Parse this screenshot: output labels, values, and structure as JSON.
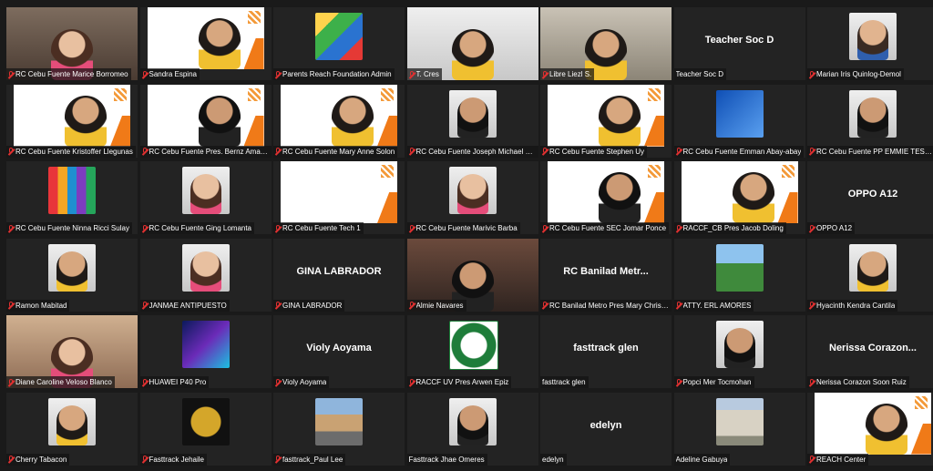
{
  "participants": [
    {
      "name": "RC Cebu Fuente Marice Borromeo",
      "muted": true,
      "type": "camera",
      "skin": "f3",
      "bg": "cam",
      "active": true
    },
    {
      "name": "Sandra Espina",
      "muted": true,
      "type": "poster-camera",
      "poster": "Rotary"
    },
    {
      "name": "Parents Reach Foundation Admin",
      "muted": true,
      "type": "logo",
      "logo": "parents"
    },
    {
      "name": "T. Cres",
      "muted": true,
      "type": "camera",
      "skin": "f2",
      "bg": "cam3"
    },
    {
      "name": "Libre Liezl S.",
      "muted": true,
      "type": "camera",
      "skin": "f2",
      "bg": "cam2"
    },
    {
      "name": "Teacher Soc D",
      "muted": false,
      "type": "name",
      "big": "Teacher Soc D"
    },
    {
      "name": "Marian Iris Quinlog-Demol",
      "muted": true,
      "type": "photo",
      "skin": "f1"
    },
    {
      "name": "RC Cebu Fuente Kristoffer Llegunas",
      "muted": true,
      "type": "poster-camera",
      "poster": "AUTISM WEBINAR"
    },
    {
      "name": "RC Cebu Fuente Pres. Bernz Amante",
      "muted": true,
      "type": "poster-camera",
      "poster": "AUTISM WEBINAR"
    },
    {
      "name": "RC Cebu Fuente Mary Anne Solon",
      "muted": true,
      "type": "poster-camera",
      "poster": "AUTISM WEBINAR"
    },
    {
      "name": "RC Cebu Fuente Joseph Michael Wong",
      "muted": true,
      "type": "photo",
      "skin": "f4"
    },
    {
      "name": "RC Cebu Fuente Stephen Uy",
      "muted": true,
      "type": "poster-camera",
      "poster": "AUTISM WEBINAR"
    },
    {
      "name": "RC Cebu Fuente Emman Abay-abay",
      "muted": true,
      "type": "logo",
      "logo": "blue-screen"
    },
    {
      "name": "RC Cebu Fuente PP EMMIE TESALONA",
      "muted": true,
      "type": "photo",
      "skin": "f4"
    },
    {
      "name": "RC Cebu Fuente Ninna Ricci Sulay",
      "muted": true,
      "type": "logo",
      "logo": "logo-doors"
    },
    {
      "name": "RC Cebu Fuente Ging Lomanta",
      "muted": true,
      "type": "photo",
      "skin": "f3"
    },
    {
      "name": "RC Cebu Fuente Tech 1",
      "muted": true,
      "type": "poster-wide",
      "poster": "AUTISM WEBINAR"
    },
    {
      "name": "RC Cebu Fuente Marivic Barba",
      "muted": true,
      "type": "photo",
      "skin": "f3"
    },
    {
      "name": "RC Cebu Fuente SEC Jomar Ponce",
      "muted": true,
      "type": "poster-camera",
      "poster": "AUTISM WEBINAR"
    },
    {
      "name": "RACCF_CB Pres Jacob Doling",
      "muted": true,
      "type": "poster-camera",
      "poster": "AUTISM WEBINAR"
    },
    {
      "name": "OPPO A12",
      "muted": true,
      "type": "name",
      "big": "OPPO A12"
    },
    {
      "name": "Ramon Mabitad",
      "muted": true,
      "type": "photo",
      "skin": "f2"
    },
    {
      "name": "JANMAE ANTIPUESTO",
      "muted": true,
      "type": "photo",
      "skin": "f3"
    },
    {
      "name": "GINA LABRADOR",
      "muted": true,
      "type": "name",
      "big": "GINA LABRADOR"
    },
    {
      "name": "Almie Navares",
      "muted": true,
      "type": "camera",
      "skin": "f4",
      "bg": "cam4"
    },
    {
      "name": "RC Banilad Metro Pres Mary Christine",
      "muted": true,
      "type": "name",
      "big": "RC Banilad Metr..."
    },
    {
      "name": "ATTY. ERL AMORES",
      "muted": true,
      "type": "logo",
      "logo": "nature"
    },
    {
      "name": "Hyacinth Kendra Cantila",
      "muted": true,
      "type": "photo",
      "skin": "f2"
    },
    {
      "name": "Diane Caroline Veloso Blanco",
      "muted": true,
      "type": "camera",
      "skin": "f3",
      "bg": "cam5"
    },
    {
      "name": "HUAWEI P40 Pro",
      "muted": true,
      "type": "logo",
      "logo": "neon"
    },
    {
      "name": "Violy Aoyama",
      "muted": true,
      "type": "name",
      "big": "Violy Aoyama"
    },
    {
      "name": "RACCF UV Pres Arwen Epiz",
      "muted": true,
      "type": "logo",
      "logo": "logo-green"
    },
    {
      "name": "fasttrack glen",
      "muted": false,
      "type": "name",
      "big": "fasttrack glen"
    },
    {
      "name": "Popci Mer Tocmohan",
      "muted": true,
      "type": "photo",
      "skin": "f4"
    },
    {
      "name": "Nerissa Corazon Soon Ruiz",
      "muted": true,
      "type": "name",
      "big": "Nerissa Corazon..."
    },
    {
      "name": "Cherry Tabacon",
      "muted": true,
      "type": "photo",
      "skin": "f2"
    },
    {
      "name": "Fasttrack Jehaile",
      "muted": true,
      "type": "logo",
      "logo": "logo-ae"
    },
    {
      "name": "fasttrack_Paul Lee",
      "muted": true,
      "type": "logo",
      "logo": "house"
    },
    {
      "name": "Fasttrack Jhae Omeres",
      "muted": false,
      "type": "photo",
      "skin": "f4"
    },
    {
      "name": "edelyn",
      "muted": false,
      "type": "name",
      "big": "edelyn"
    },
    {
      "name": "Adeline Gabuya",
      "muted": false,
      "type": "logo",
      "logo": "building"
    },
    {
      "name": "REACH Center",
      "muted": true,
      "type": "poster-camera",
      "poster": "AUTISM WEBINAR"
    }
  ]
}
